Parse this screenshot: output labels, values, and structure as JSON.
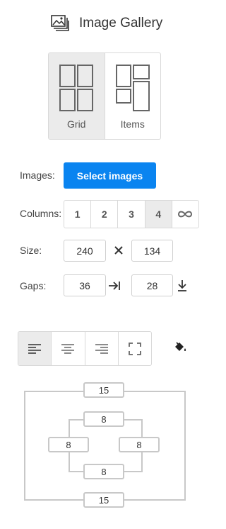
{
  "header": {
    "title": "Image Gallery",
    "icon": "gallery-icon"
  },
  "layout": {
    "options": [
      {
        "label": "Grid",
        "active": true
      },
      {
        "label": "Items",
        "active": false
      }
    ]
  },
  "images": {
    "label": "Images:",
    "button": "Select images"
  },
  "columns": {
    "label": "Columns:",
    "options": [
      "1",
      "2",
      "3",
      "4"
    ],
    "selected": "4",
    "extra_icon": "infinity-icon"
  },
  "size": {
    "label": "Size:",
    "width": "240",
    "height": "134",
    "separator_icon": "times-icon"
  },
  "gaps": {
    "label": "Gaps:",
    "horizontal": "36",
    "vertical": "28",
    "horizontal_icon": "arrow-right-to-line-icon",
    "vertical_icon": "arrow-down-to-line-icon"
  },
  "alignment": {
    "options": [
      "align-left-icon",
      "align-center-icon",
      "align-right-icon",
      "fullscreen-icon"
    ],
    "selected": "align-left-icon"
  },
  "background": {
    "icon": "paint-bucket-icon"
  },
  "spacing": {
    "margin_top": "15",
    "margin_bottom": "15",
    "padding_top": "8",
    "padding_left": "8",
    "padding_right": "8",
    "padding_bottom": "8"
  }
}
